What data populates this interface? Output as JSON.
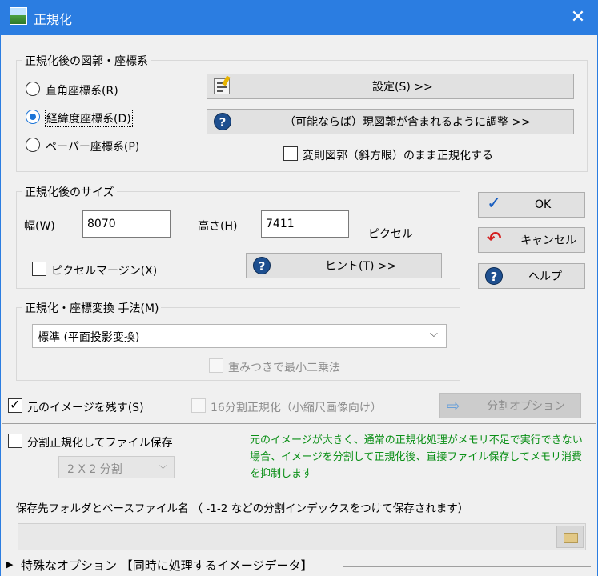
{
  "window": {
    "title": "正規化",
    "close_glyph": "✕"
  },
  "coord_group": {
    "legend": "正規化後の図郭・座標系",
    "radios": [
      {
        "label": "直角座標系(R)",
        "checked": false
      },
      {
        "label": "経緯度座標系(D)",
        "checked": true
      },
      {
        "label": "ペーパー座標系(P)",
        "checked": false
      }
    ],
    "settings_button": "設定(S) >>",
    "adjust_button": "（可能ならば）現図郭が含まれるように調整 >>",
    "deform_checkbox": "変則図郭（斜方眼）のまま正規化する"
  },
  "size_group": {
    "legend": "正規化後のサイズ",
    "width_label": "幅(W)",
    "width_value": "8070",
    "height_label": "高さ(H)",
    "height_value": "7411",
    "unit": "ピクセル",
    "margin_checkbox": "ピクセルマージン(X)",
    "hint_button": "ヒント(T) >>"
  },
  "buttons": {
    "ok": "OK",
    "cancel": "キャンセル",
    "help": "ヘルプ"
  },
  "method_group": {
    "legend": "正規化・座標変換 手法(M)",
    "selected": "標準 (平面投影変換)",
    "weighted_checkbox": "重みつきで最小二乗法"
  },
  "keep_original": {
    "label": "元のイメージを残す(S)",
    "checked": true
  },
  "split16": {
    "label": "16分割正規化（小縮尺画像向け）",
    "checked": false
  },
  "split_option_button": "分割オプション",
  "split_save": {
    "label": "分割正規化してファイル保存",
    "checked": false
  },
  "split_select": "2 X 2 分割",
  "notice": "元のイメージが大きく、通常の正規化処理がメモリ不足で実行できない場合、イメージを分割して正規化後、直接ファイル保存してメモリ消費を抑制します",
  "save_folder_label": "保存先フォルダとベースファイル名 （ -1-2 などの分割インデックスをつけて保存されます）",
  "save_path_value": "",
  "special_options": "特殊なオプション 【同時に処理するイメージデータ】",
  "colors": {
    "titlebar": "#2b7de1",
    "notice": "#0a8f16",
    "accent": "#1a74d8"
  }
}
